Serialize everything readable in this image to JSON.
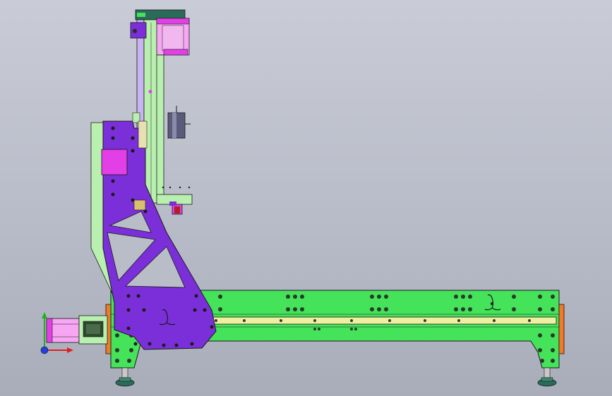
{
  "scene": {
    "background_top": "#c9ccd6",
    "background_bottom": "#a9adb9",
    "colors": {
      "base_green": "#44e35a",
      "light_green": "#b9f0b0",
      "purple": "#7b2fd8",
      "magenta": "#e23fe6",
      "pink": "#f6a6f2",
      "rail_yellow": "#eef0a0",
      "end_orange": "#f07a2a",
      "dark_teal": "#2a6b5a",
      "outline": "#1a1a1a"
    }
  },
  "triad": {
    "x_axis_color": "#e02020",
    "y_axis_color": "#20b020",
    "z_axis_color": "#2040e0"
  }
}
